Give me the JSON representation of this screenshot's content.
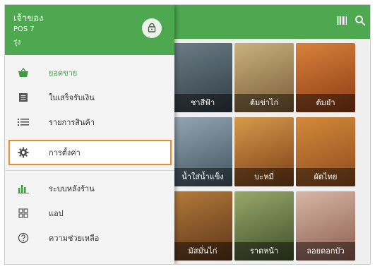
{
  "drawer": {
    "title": "เจ้าของ",
    "subtitle": "POS 7",
    "sub2": "รุ่ง"
  },
  "menu_items": [
    {
      "label": "ยอดขาย"
    },
    {
      "label": "ใบเสร็จรับเงิน"
    },
    {
      "label": "รายการสินค้า"
    },
    {
      "label": "การตั้งค่า"
    },
    {
      "label": "ระบบหลังร้าน"
    },
    {
      "label": "แอป"
    },
    {
      "label": "ความช่วยเหลือ"
    }
  ],
  "tiles": [
    {
      "caption": "ชาสีฟ้า"
    },
    {
      "caption": "ต้มข่าไก่"
    },
    {
      "caption": "ต้มยำ"
    },
    {
      "caption": "น้ำใส่น้ำแข็ง"
    },
    {
      "caption": "บะหมี่"
    },
    {
      "caption": "ผัดไทย"
    },
    {
      "caption": "มัสมั่นไก่"
    },
    {
      "caption": "ราดหน้า"
    },
    {
      "caption": "ลอยดอกบัว"
    }
  ],
  "colors": {
    "brand_green": "#4da850",
    "accent_green": "#3e9a44",
    "highlight_orange": "#f08a2e"
  }
}
